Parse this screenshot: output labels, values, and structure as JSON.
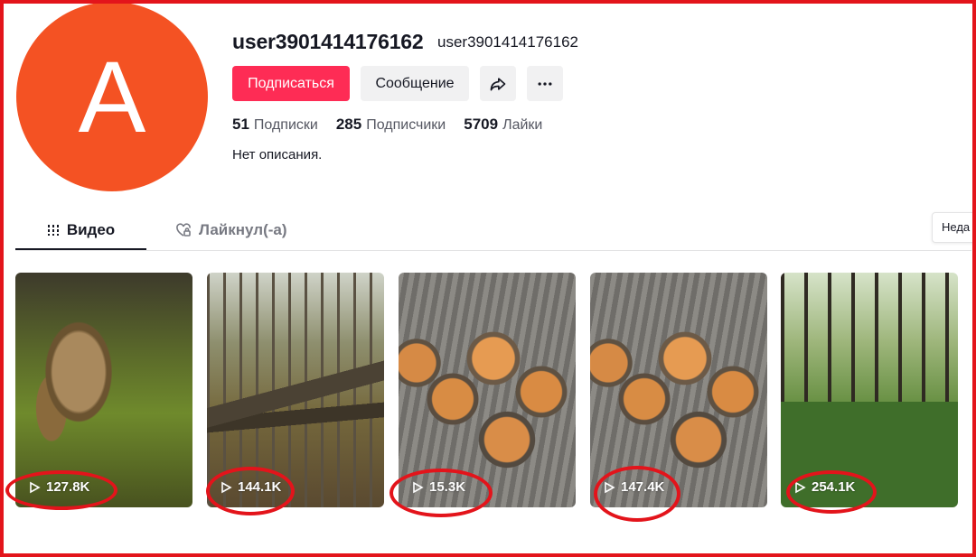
{
  "profile": {
    "avatar_letter": "A",
    "avatar_color": "#f45223",
    "username": "user3901414176162",
    "nickname": "user3901414176162",
    "bio": "Нет описания."
  },
  "actions": {
    "follow_label": "Подписаться",
    "message_label": "Сообщение",
    "share_icon": "share-icon",
    "more_icon": "more-icon",
    "accent_color": "#fe2c55"
  },
  "stats": {
    "following_count": "51",
    "following_label": "Подписки",
    "followers_count": "285",
    "followers_label": "Подписчики",
    "likes_count": "5709",
    "likes_label": "Лайки"
  },
  "tabs": [
    {
      "label": "Видео",
      "icon": "grid-icon",
      "active": true
    },
    {
      "label": "Лайкнул(-а)",
      "icon": "heart-lock-icon",
      "active": false
    }
  ],
  "sort": {
    "label": "Неда"
  },
  "videos": [
    {
      "views": "127.8K"
    },
    {
      "views": "144.1K"
    },
    {
      "views": "15.3K"
    },
    {
      "views": "147.4K"
    },
    {
      "views": "254.1K"
    }
  ],
  "annotation": {
    "border_color": "#e3141b"
  }
}
